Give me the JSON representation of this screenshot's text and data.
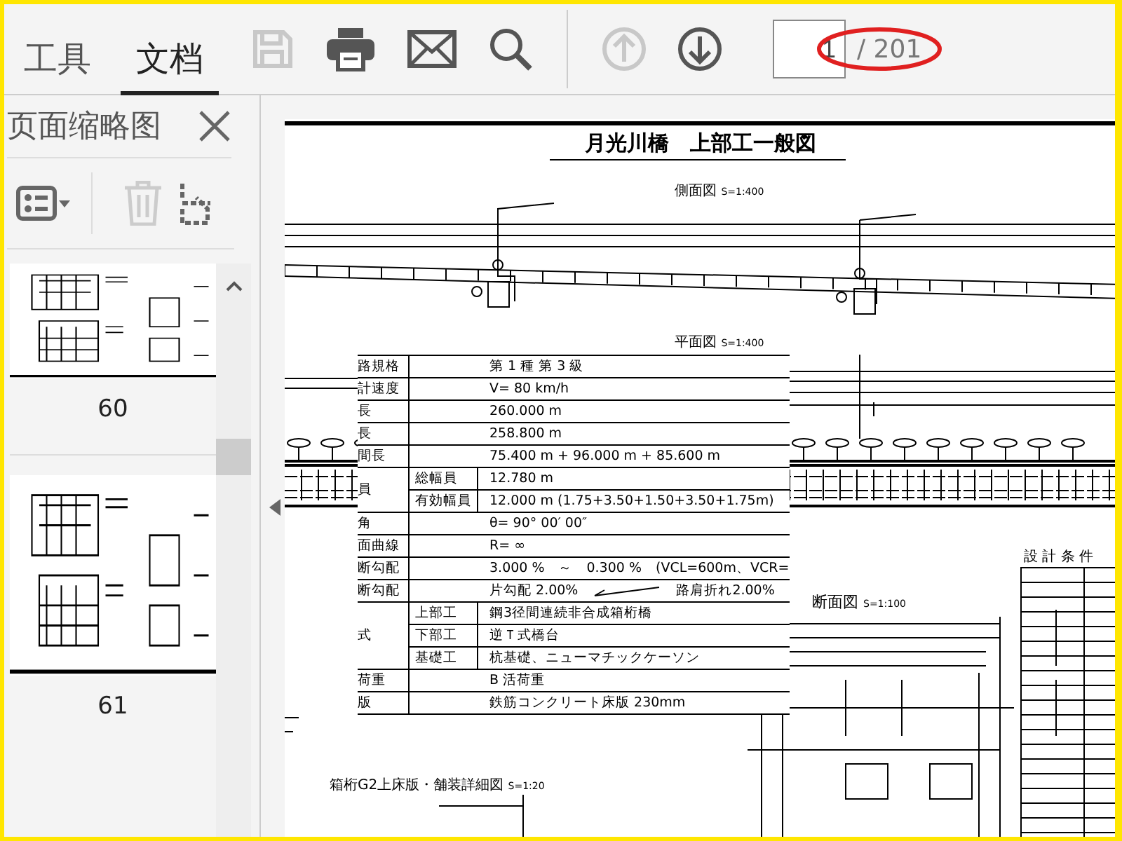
{
  "tabs": [
    {
      "label": "工具",
      "selected": false
    },
    {
      "label": "文档",
      "selected": true
    }
  ],
  "toolbar": [
    {
      "kind": "save",
      "disabled": true
    },
    {
      "kind": "print",
      "disabled": false
    },
    {
      "kind": "mail",
      "disabled": false
    },
    {
      "kind": "search",
      "disabled": false
    },
    {
      "kind": "divider"
    },
    {
      "kind": "up",
      "disabled": true
    },
    {
      "kind": "down",
      "disabled": false
    }
  ],
  "page_field": {
    "value": "1",
    "total": "/ 201"
  },
  "sidebar": {
    "title": "页面缩略图",
    "tools": [
      {
        "kind": "list",
        "disabled": false
      },
      {
        "kind": "trash",
        "disabled": true
      },
      {
        "kind": "extract",
        "disabled": false
      }
    ],
    "thumbnails": [
      {
        "label": "60"
      },
      {
        "label": "61"
      }
    ]
  },
  "document": {
    "title": "月光川橋　上部工一般図",
    "side_view": {
      "label": "側面図",
      "scale": "S=1:400"
    },
    "plan_view": {
      "label": "平面図",
      "scale": "S=1:400"
    },
    "section_view": {
      "label": "断面図",
      "scale": "S=1:100"
    },
    "conditions_title": "設 計 条 件",
    "detail_view": {
      "label": "箱桁G2上床版・舗装詳細図",
      "scale": "S=1:20"
    },
    "table": [
      {
        "label": "路規格",
        "value": "第 1 種 第 3 級"
      },
      {
        "label": "計速度",
        "value": "V= 80 km/h"
      },
      {
        "label": "長",
        "value": "260.000 m"
      },
      {
        "label": "長",
        "value": "258.800 m"
      },
      {
        "label": "間長",
        "value": "75.400 m + 96.000 m + 85.600 m"
      },
      {
        "label": "員",
        "sub": [
          {
            "label": "総幅員",
            "value": "12.780 m"
          },
          {
            "label": "有効幅員",
            "value": "12.000 m (1.75+3.50+1.50+3.50+1.75m)"
          }
        ]
      },
      {
        "label": "角",
        "value": "θ= 90° 00′ 00″"
      },
      {
        "label": "面曲線",
        "value": "R= ∞"
      },
      {
        "label": "断勾配",
        "value": "3.000 %　～　0.300 %　(VCL=600m、VCR="
      },
      {
        "label": "断勾配",
        "value": "片勾配 2.00%",
        "value_right": "路肩折れ2.00%"
      },
      {
        "label": "式",
        "sub": [
          {
            "label": "上部工",
            "value": "鋼3径間連続非合成箱桁橋"
          },
          {
            "label": "下部工",
            "value": "逆Ｔ式橋台"
          },
          {
            "label": "基礎工",
            "value": "杭基礎、ニューマチックケーソン"
          }
        ]
      },
      {
        "label": "荷重",
        "value": "B 活荷重"
      },
      {
        "label": "版",
        "value": "鉄筋コンクリート床版 230mm"
      }
    ]
  }
}
